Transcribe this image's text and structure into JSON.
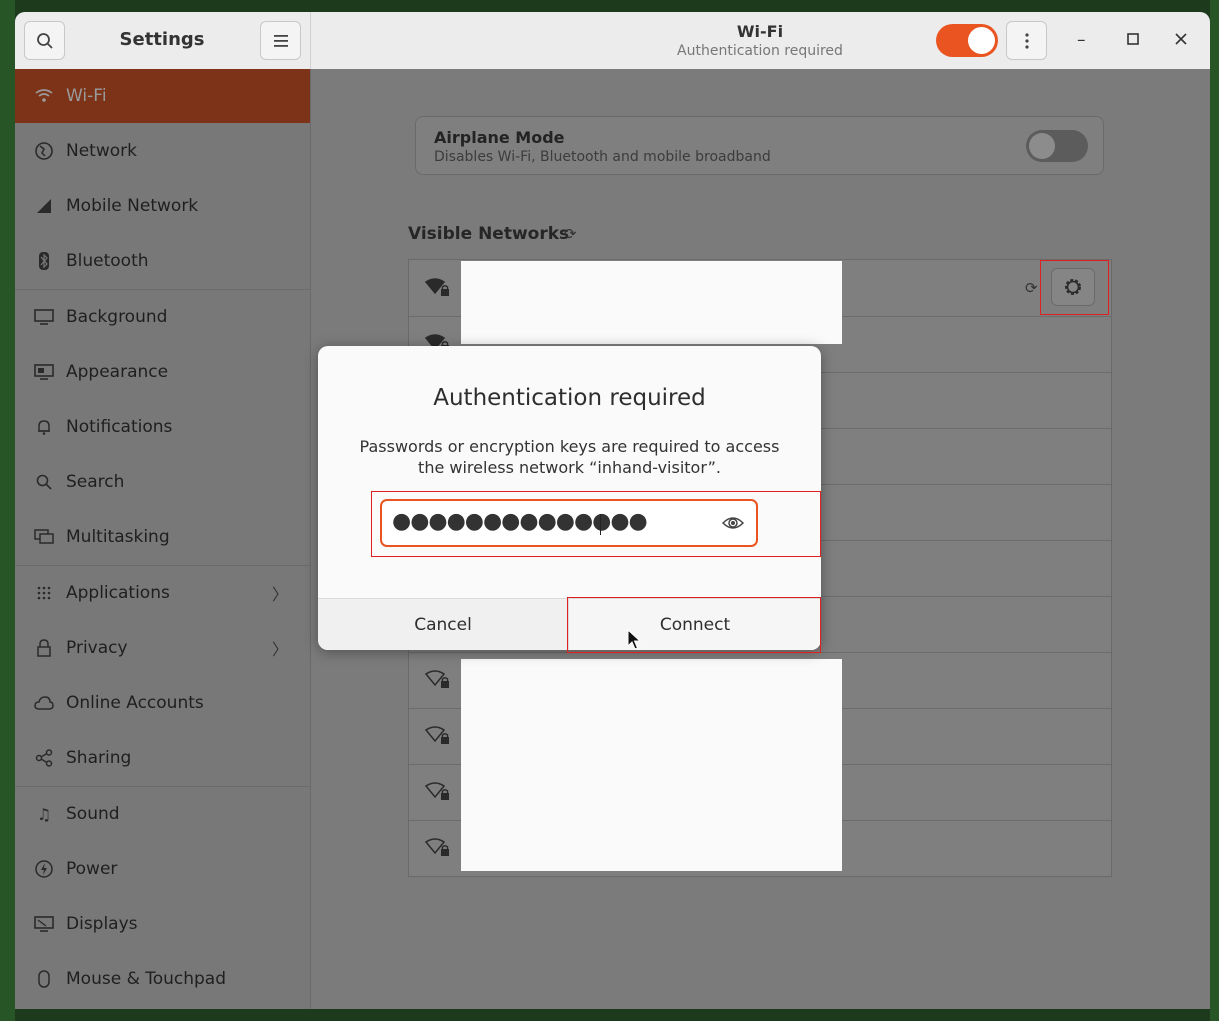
{
  "app": {
    "title": "Settings",
    "search_icon": "search-icon",
    "menu_icon": "hamburger-menu-icon"
  },
  "panel": {
    "title": "Wi-Fi",
    "subtitle": "Authentication required",
    "wifi_toggle_on": true
  },
  "sidebar": {
    "items": [
      {
        "label": "Wi-Fi",
        "icon": "wifi-icon",
        "active": true
      },
      {
        "label": "Network",
        "icon": "network-globe-icon"
      },
      {
        "label": "Mobile Network",
        "icon": "mobile-signal-icon"
      },
      {
        "label": "Bluetooth",
        "icon": "bluetooth-icon"
      },
      {
        "label": "Background",
        "icon": "background-icon"
      },
      {
        "label": "Appearance",
        "icon": "appearance-icon"
      },
      {
        "label": "Notifications",
        "icon": "bell-icon"
      },
      {
        "label": "Search",
        "icon": "search-icon"
      },
      {
        "label": "Multitasking",
        "icon": "multitasking-icon"
      },
      {
        "label": "Applications",
        "icon": "grid-icon",
        "chevron": true
      },
      {
        "label": "Privacy",
        "icon": "lock-icon",
        "chevron": true
      },
      {
        "label": "Online Accounts",
        "icon": "cloud-icon"
      },
      {
        "label": "Sharing",
        "icon": "share-icon"
      },
      {
        "label": "Sound",
        "icon": "music-note-icon"
      },
      {
        "label": "Power",
        "icon": "power-icon"
      },
      {
        "label": "Displays",
        "icon": "display-icon"
      },
      {
        "label": "Mouse & Touchpad",
        "icon": "mouse-icon"
      }
    ]
  },
  "airplane": {
    "title": "Airplane Mode",
    "subtitle": "Disables Wi-Fi, Bluetooth and mobile broadband",
    "enabled": false
  },
  "networks": {
    "heading": "Visible Networks",
    "row_count": 11
  },
  "dialog": {
    "title": "Authentication required",
    "message": "Passwords or encryption keys are required to access the wireless network “inhand-visitor”.",
    "password_masked": "●●●●●●●●●●●●●●",
    "cancel_label": "Cancel",
    "connect_label": "Connect"
  }
}
